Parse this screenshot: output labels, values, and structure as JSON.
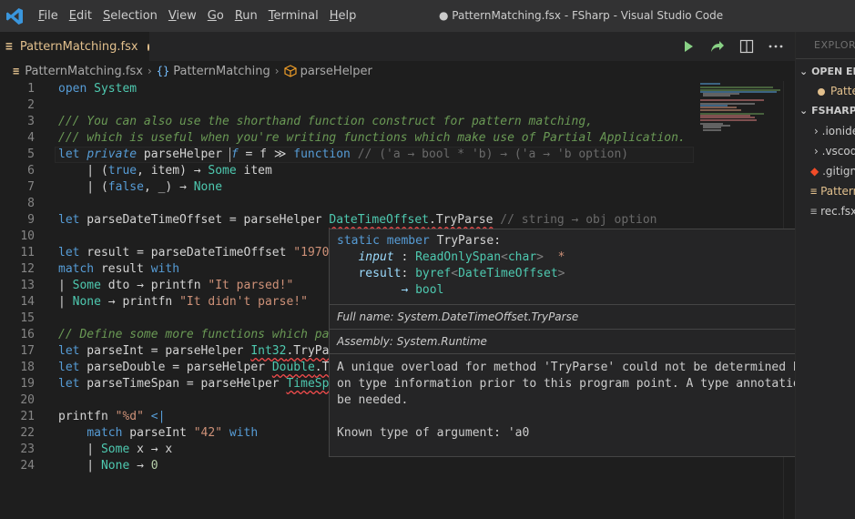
{
  "window": {
    "title": "● PatternMatching.fsx - FSharp - Visual Studio Code",
    "menu": [
      {
        "pre": "",
        "u": "F",
        "post": "ile"
      },
      {
        "pre": "",
        "u": "E",
        "post": "dit"
      },
      {
        "pre": "",
        "u": "S",
        "post": "election"
      },
      {
        "pre": "",
        "u": "V",
        "post": "iew"
      },
      {
        "pre": "",
        "u": "G",
        "post": "o"
      },
      {
        "pre": "",
        "u": "R",
        "post": "un"
      },
      {
        "pre": "",
        "u": "T",
        "post": "erminal"
      },
      {
        "pre": "",
        "u": "H",
        "post": "elp"
      }
    ]
  },
  "tab": {
    "label": "PatternMatching.fsx",
    "icon": "≡"
  },
  "breadcrumb": {
    "file": "PatternMatching.fsx",
    "namespace_icon": "{}",
    "namespace": "PatternMatching",
    "function": "parseHelper"
  },
  "editor": {
    "line_numbers": [
      "1",
      "2",
      "3",
      "4",
      "5",
      "6",
      "7",
      "8",
      "9",
      "10",
      "11",
      "12",
      "13",
      "14",
      "15",
      "16",
      "17",
      "18",
      "19",
      "20",
      "21",
      "22",
      "23",
      "24"
    ]
  },
  "hover": {
    "sig_line1_kw": "static member",
    "sig_line1_name": "TryParse",
    "sig_line1_colon": ":",
    "param1": "input",
    "param1_type": "ReadOnlySpan",
    "param1_targ": "char",
    "param1_suffix": "*",
    "param2": "result",
    "param2_type_kw": "byref",
    "param2_targ": "DateTimeOffset",
    "arrow": "→",
    "ret_type": "bool",
    "full_name": "Full name: System.DateTimeOffset.TryParse",
    "assembly": "Assembly: System.Runtime",
    "message": "A unique overload for method 'TryParse' could not be determined based on type information prior to this program point. A type annotation may be needed.",
    "known_type": "Known type of argument: 'a0"
  },
  "sidebar": {
    "title": "EXPLORER",
    "open_editors": "OPEN EDITORS",
    "open_file": "PatternMatching.fsx",
    "folder": "FSHARP",
    "items": [
      ".ionide",
      ".vscode",
      ".gitignore",
      "PatternMatching.fsx",
      "rec.fsx"
    ]
  },
  "colors": {
    "accent_tab": "#e2c08d",
    "error": "#f14c4c",
    "keyword": "#569cd6",
    "type": "#4ec9b0"
  }
}
